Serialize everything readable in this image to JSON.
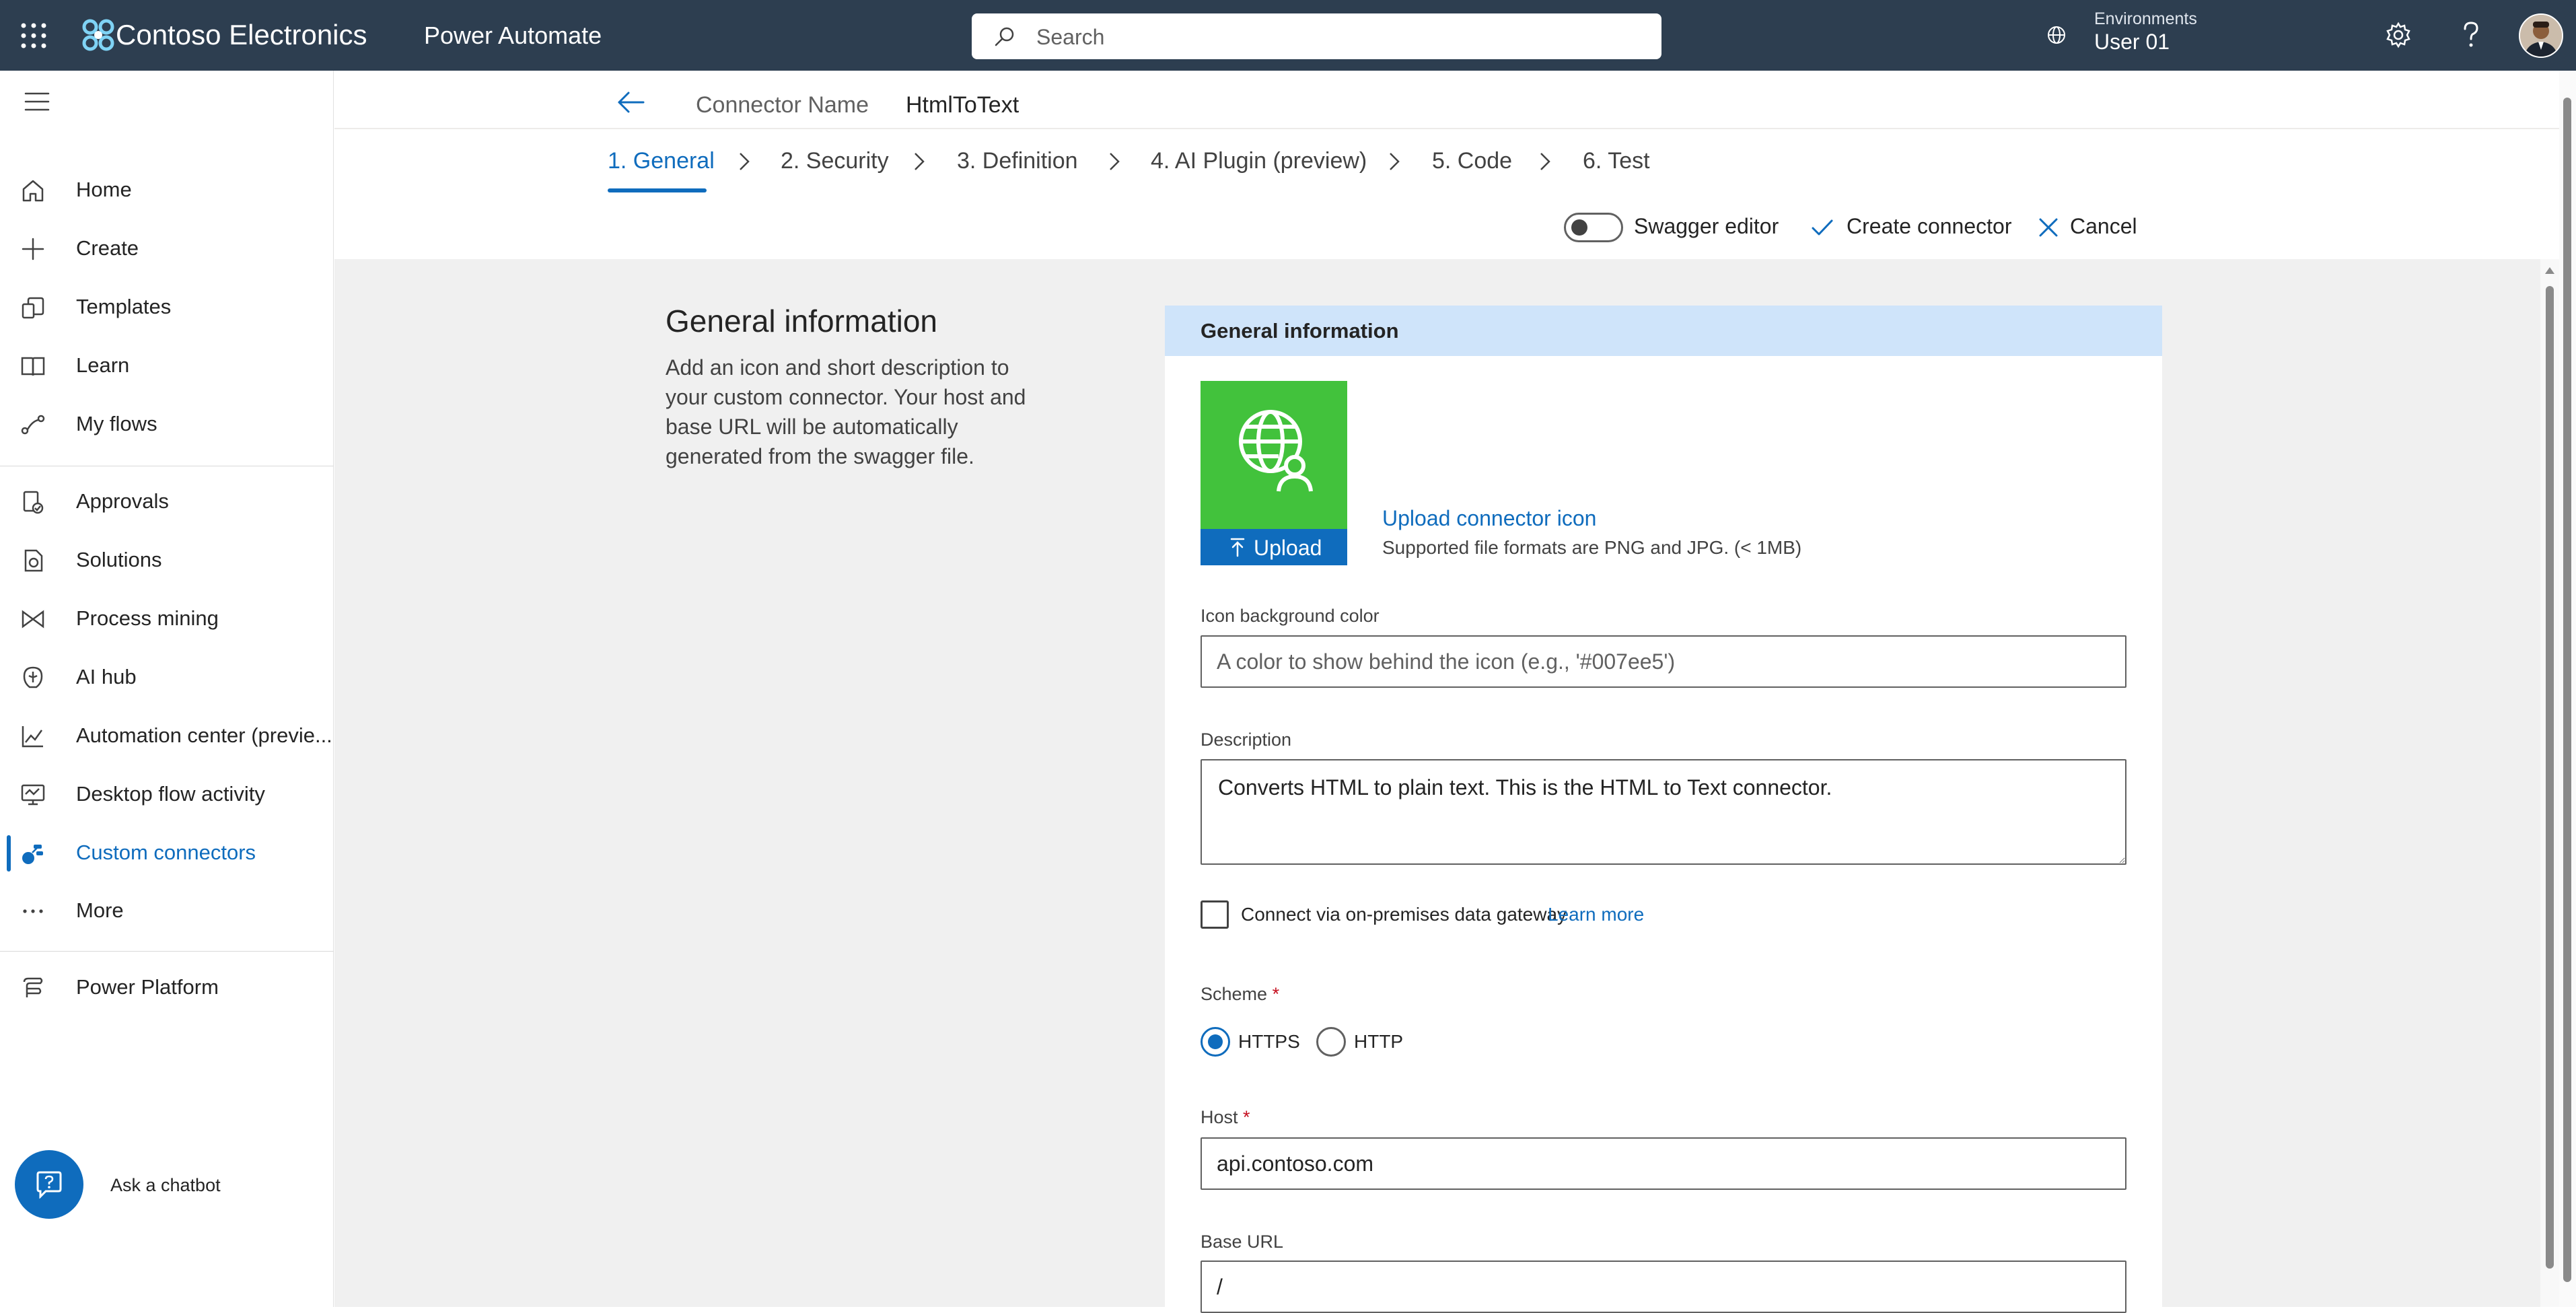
{
  "topbar": {
    "brand_name": "Contoso Electronics",
    "product_name": "Power Automate",
    "search_placeholder": "Search",
    "environment_label": "Environments",
    "environment_value": "User 01",
    "bg_color": "#2d3e50"
  },
  "nav": {
    "items": [
      {
        "label": "Home",
        "icon": "home-icon"
      },
      {
        "label": "Create",
        "icon": "plus-icon"
      },
      {
        "label": "Templates",
        "icon": "templates-icon"
      },
      {
        "label": "Learn",
        "icon": "book-icon"
      },
      {
        "label": "My flows",
        "icon": "flows-icon"
      },
      {
        "label": "Approvals",
        "icon": "approvals-icon"
      },
      {
        "label": "Solutions",
        "icon": "solutions-icon"
      },
      {
        "label": "Process mining",
        "icon": "process-mining-icon"
      },
      {
        "label": "AI hub",
        "icon": "ai-hub-icon"
      },
      {
        "label": "Automation center (previe...",
        "icon": "chart-line-icon"
      },
      {
        "label": "Desktop flow activity",
        "icon": "desktop-flow-icon"
      },
      {
        "label": "Custom connectors",
        "icon": "custom-connector-icon",
        "active": true
      },
      {
        "label": "More",
        "icon": "more-icon"
      },
      {
        "label": "Power Platform",
        "icon": "power-platform-icon"
      }
    ],
    "chatbot_label": "Ask a chatbot",
    "accent_color": "#0f6cbd"
  },
  "header": {
    "connector_label": "Connector Name",
    "connector_value": "HtmlToText",
    "steps": [
      "1. General",
      "2. Security",
      "3. Definition",
      "4. AI Plugin (preview)",
      "5. Code",
      "6. Test"
    ],
    "active_step": 0,
    "swagger_label": "Swagger editor",
    "swagger_on": false,
    "create_label": "Create connector",
    "cancel_label": "Cancel"
  },
  "side": {
    "title": "General information",
    "description": "Add an icon and short description to your custom connector. Your host and base URL will be automatically generated from the swagger file."
  },
  "form": {
    "section_title": "General information",
    "icon_tile_color": "#42c23c",
    "upload_button": "Upload",
    "upload_link": "Upload connector icon",
    "upload_hint": "Supported file formats are PNG and JPG. (< 1MB)",
    "icon_bg_label": "Icon background color",
    "icon_bg_placeholder": "A color to show behind the icon (e.g., '#007ee5')",
    "icon_bg_value": "",
    "description_label": "Description",
    "description_value": "Converts HTML to plain text. This is the HTML to Text connector.",
    "gateway_label": "Connect via on-premises data gateway",
    "gateway_link": "Learn more",
    "gateway_checked": false,
    "scheme_label": "Scheme",
    "scheme_options": [
      "HTTPS",
      "HTTP"
    ],
    "scheme_selected": "HTTPS",
    "host_label": "Host",
    "host_value": "api.contoso.com",
    "base_url_label": "Base URL",
    "base_url_value": "/",
    "required_marker": "*"
  }
}
